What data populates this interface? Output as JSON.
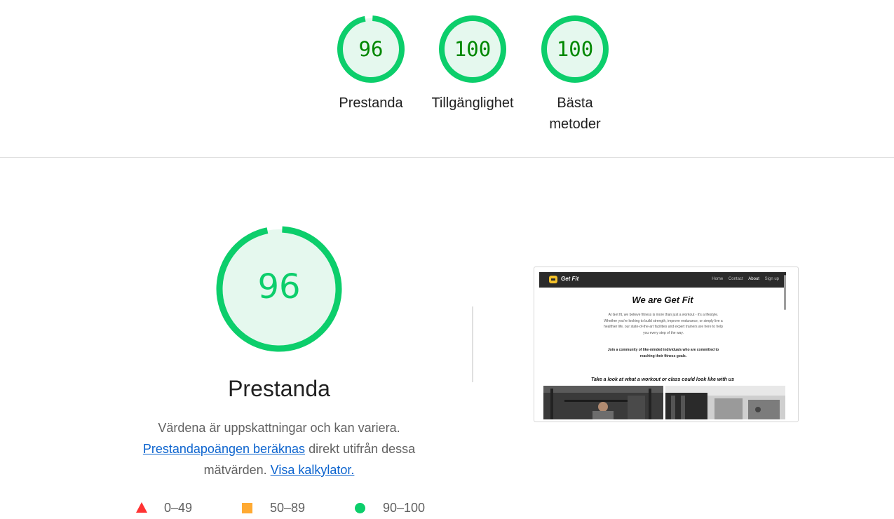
{
  "summary": {
    "gauges": [
      {
        "score": "96",
        "label": "Prestanda",
        "value": 96
      },
      {
        "score": "100",
        "label": "Tillgänglighet",
        "value": 100
      },
      {
        "score": "100",
        "label_line1": "Bästa",
        "label_line2": "metoder",
        "value": 100
      }
    ]
  },
  "performance": {
    "score": "96",
    "value": 96,
    "title": "Prestanda",
    "description_1": "Värdena är uppskattningar och kan variera.",
    "link_1": "Prestandapoängen beräknas",
    "description_2": "direkt utifrån dessa mätvärden.",
    "link_2": "Visa kalkylator."
  },
  "legend": [
    {
      "range": "0–49",
      "shape": "triangle",
      "color": "#ff3333"
    },
    {
      "range": "50–89",
      "shape": "square",
      "color": "#ffaa33"
    },
    {
      "range": "90–100",
      "shape": "circle",
      "color": "#0cce6b"
    }
  ],
  "colors": {
    "pass": "#0cce6b",
    "pass_text": "#008800",
    "pass_fill": "#e5f8ee",
    "link": "#0b63ce"
  },
  "thumbnail": {
    "brand": "Get Fit",
    "nav_links": [
      "Home",
      "Contact",
      "About",
      "Sign up"
    ],
    "heading": "We are Get Fit",
    "body": "At Get fit, we believe fitness is more than just a workout - it's a lifestyle. Whether you're looking to build strength, improve endurance, or simply live a healthier life, our state-of-the-art facilities and expert trainers are here to help you every step of the way.",
    "join": "Join a community of like-minded individuals who are committed to reaching their fitness goals.",
    "subheading": "Take a look at what a workout or class could look like with us"
  }
}
